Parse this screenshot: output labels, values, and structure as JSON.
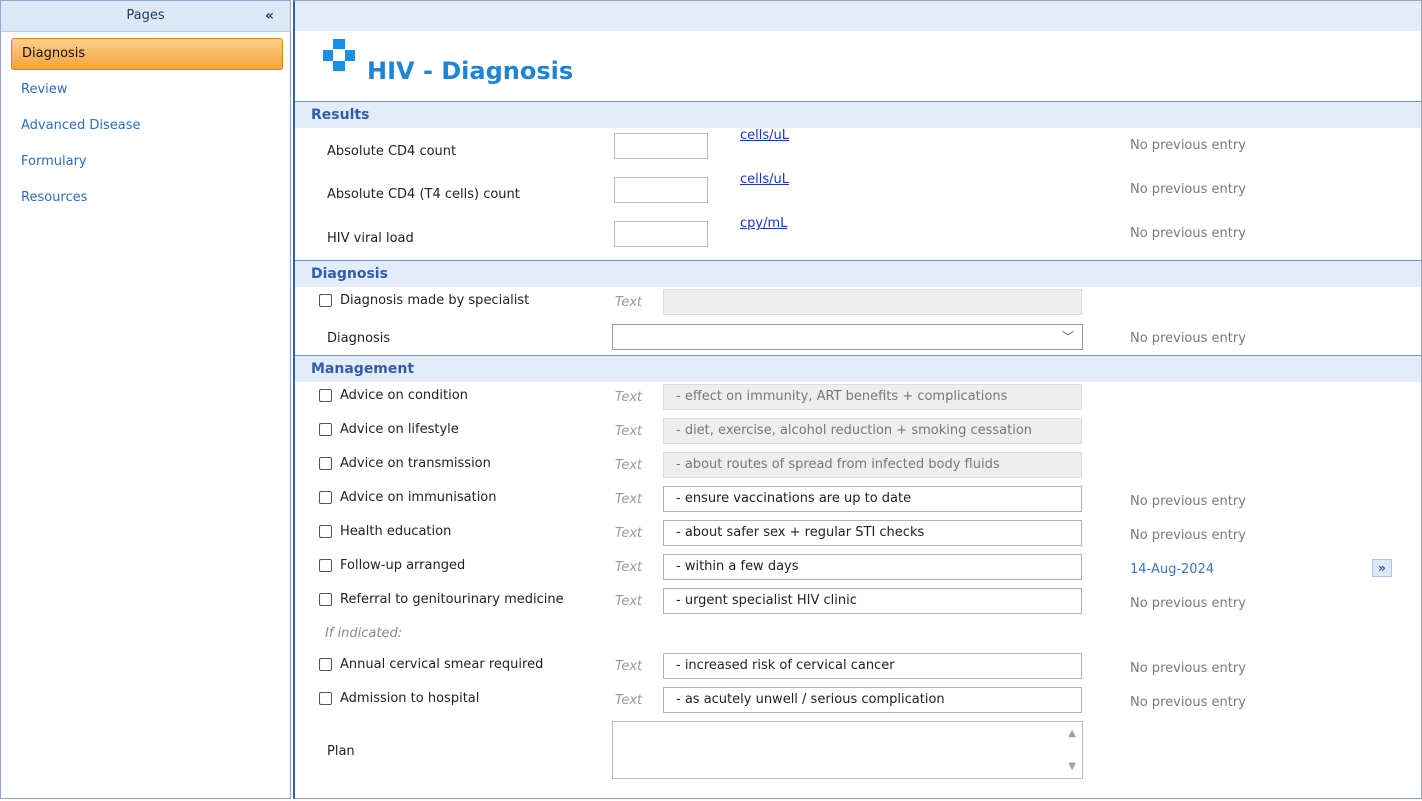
{
  "sidebar": {
    "header": "Pages",
    "collapse_glyph": "«",
    "items": [
      {
        "label": "Diagnosis",
        "active": true
      },
      {
        "label": "Review"
      },
      {
        "label": "Advanced Disease"
      },
      {
        "label": "Formulary"
      },
      {
        "label": "Resources"
      }
    ]
  },
  "page": {
    "title": "HIV - Diagnosis",
    "logo_icon": "medical-cross-icon",
    "accent": "#1e84d6"
  },
  "results": {
    "heading": "Results",
    "rows": [
      {
        "label": "Absolute CD4 count",
        "value": "",
        "unit": "cells/uL",
        "previous": "No previous entry"
      },
      {
        "label": "Absolute CD4 (T4 cells) count",
        "value": "",
        "unit": "cells/uL",
        "previous": "No previous entry"
      },
      {
        "label": "HIV viral load",
        "value": "",
        "unit": "cpy/mL",
        "previous": "No previous entry"
      }
    ]
  },
  "diagnosis": {
    "heading": "Diagnosis",
    "specialist": {
      "label": "Diagnosis made by specialist",
      "hint": "Text",
      "value": ""
    },
    "select": {
      "label": "Diagnosis",
      "value": "",
      "previous": "No previous entry"
    }
  },
  "management": {
    "heading": "Management",
    "items": [
      {
        "label": "Advice on condition",
        "hint": "Text",
        "value": "- effect on immunity, ART benefits + complications",
        "previous": ""
      },
      {
        "label": "Advice on lifestyle",
        "hint": "Text",
        "value": "- diet, exercise, alcohol reduction + smoking cessation",
        "previous": ""
      },
      {
        "label": "Advice on transmission",
        "hint": "Text",
        "value": "- about routes of spread from infected body fluids",
        "previous": ""
      },
      {
        "label": "Advice on immunisation",
        "hint": "Text",
        "value": "- ensure vaccinations are up to date",
        "previous": "No previous entry"
      },
      {
        "label": "Health education",
        "hint": "Text",
        "value": "- about safer sex + regular STI checks",
        "previous": "No previous entry"
      },
      {
        "label": "Follow-up arranged",
        "hint": "Text",
        "value": "- within a few days",
        "previous": "14-Aug-2024"
      },
      {
        "label": "Referral to genitourinary medicine",
        "hint": "Text",
        "value": "- urgent specialist HIV clinic",
        "previous": "No previous entry"
      }
    ],
    "if_indicated": "If indicated:",
    "indicated_items": [
      {
        "label": "Annual cervical smear required",
        "hint": "Text",
        "value": "- increased risk of cervical cancer",
        "previous": "No previous entry"
      },
      {
        "label": "Admission to hospital",
        "hint": "Text",
        "value": "- as acutely unwell / serious complication",
        "previous": "No previous entry"
      }
    ],
    "plan": {
      "label": "Plan",
      "value": ""
    },
    "more_glyph": "»"
  }
}
